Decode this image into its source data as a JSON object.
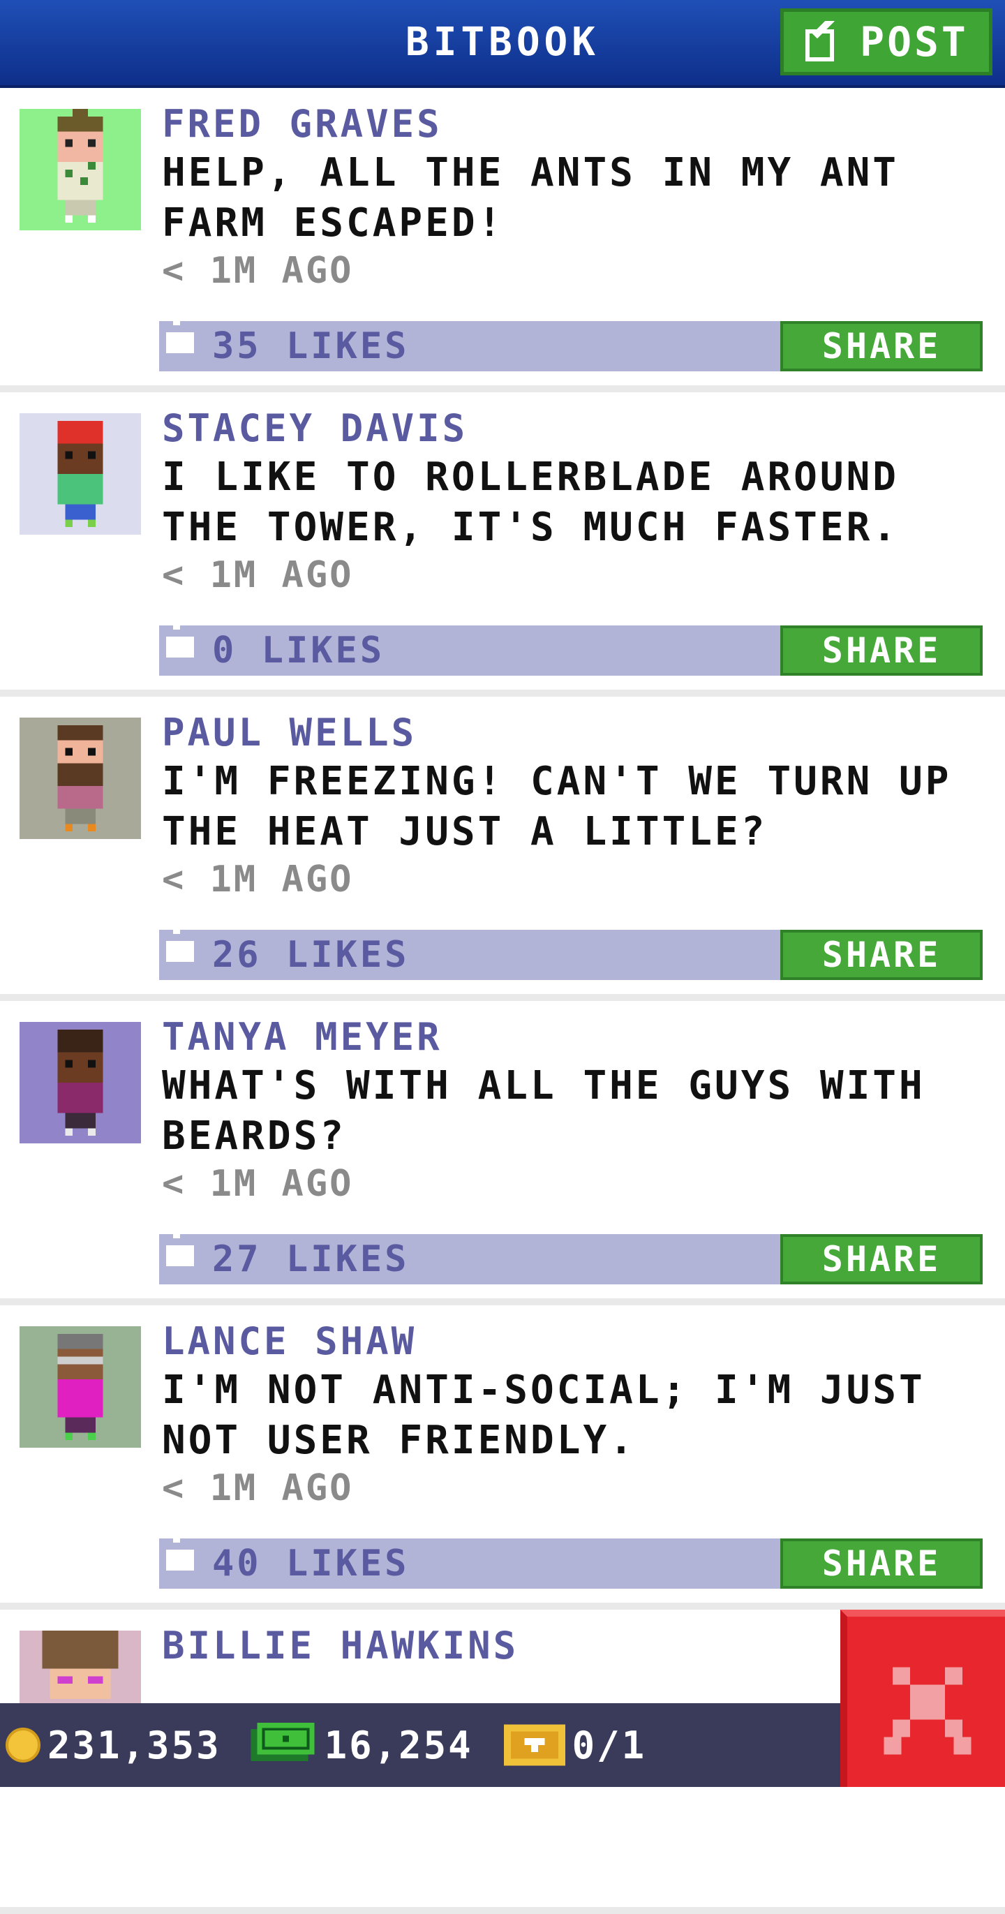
{
  "header": {
    "title": "BITBOOK",
    "post_label": "POST"
  },
  "posts": [
    {
      "name": "FRED GRAVES",
      "message": "HELP, ALL THE ANTS IN MY ANT FARM ESCAPED!",
      "time": "< 1M AGO",
      "likes": "35 LIKES",
      "share": "SHARE",
      "avatar_bg": "#8ef08a"
    },
    {
      "name": "STACEY DAVIS",
      "message": "I LIKE TO ROLLERBLADE AROUND THE TOWER, IT'S MUCH FASTER.",
      "time": "< 1M AGO",
      "likes": "0 LIKES",
      "share": "SHARE",
      "avatar_bg": "#dcdcef"
    },
    {
      "name": "PAUL WELLS",
      "message": "I'M FREEZING! CAN'T WE TURN UP THE HEAT JUST A LITTLE?",
      "time": "< 1M AGO",
      "likes": "26 LIKES",
      "share": "SHARE",
      "avatar_bg": "#a9a999"
    },
    {
      "name": "TANYA MEYER",
      "message": "WHAT'S WITH ALL THE GUYS WITH BEARDS?",
      "time": "< 1M AGO",
      "likes": "27 LIKES",
      "share": "SHARE",
      "avatar_bg": "#9184c8"
    },
    {
      "name": "LANCE SHAW",
      "message": "I'M NOT ANTI-SOCIAL; I'M JUST NOT USER FRIENDLY.",
      "time": "< 1M AGO",
      "likes": "40 LIKES",
      "share": "SHARE",
      "avatar_bg": "#97b393"
    },
    {
      "name": "BILLIE HAWKINS",
      "message": "",
      "time": "",
      "likes": "",
      "share": "",
      "avatar_bg": "#d9b7c7"
    }
  ],
  "bottom_bar": {
    "coins": "231,353",
    "bux": "16,254",
    "tickets": "0/1"
  },
  "colors": {
    "header_blue": "#1f4fb6",
    "share_green": "#46a839",
    "likes_bar": "#b1b3d7",
    "name_purple": "#5a5aa0",
    "close_red": "#e7272d"
  }
}
